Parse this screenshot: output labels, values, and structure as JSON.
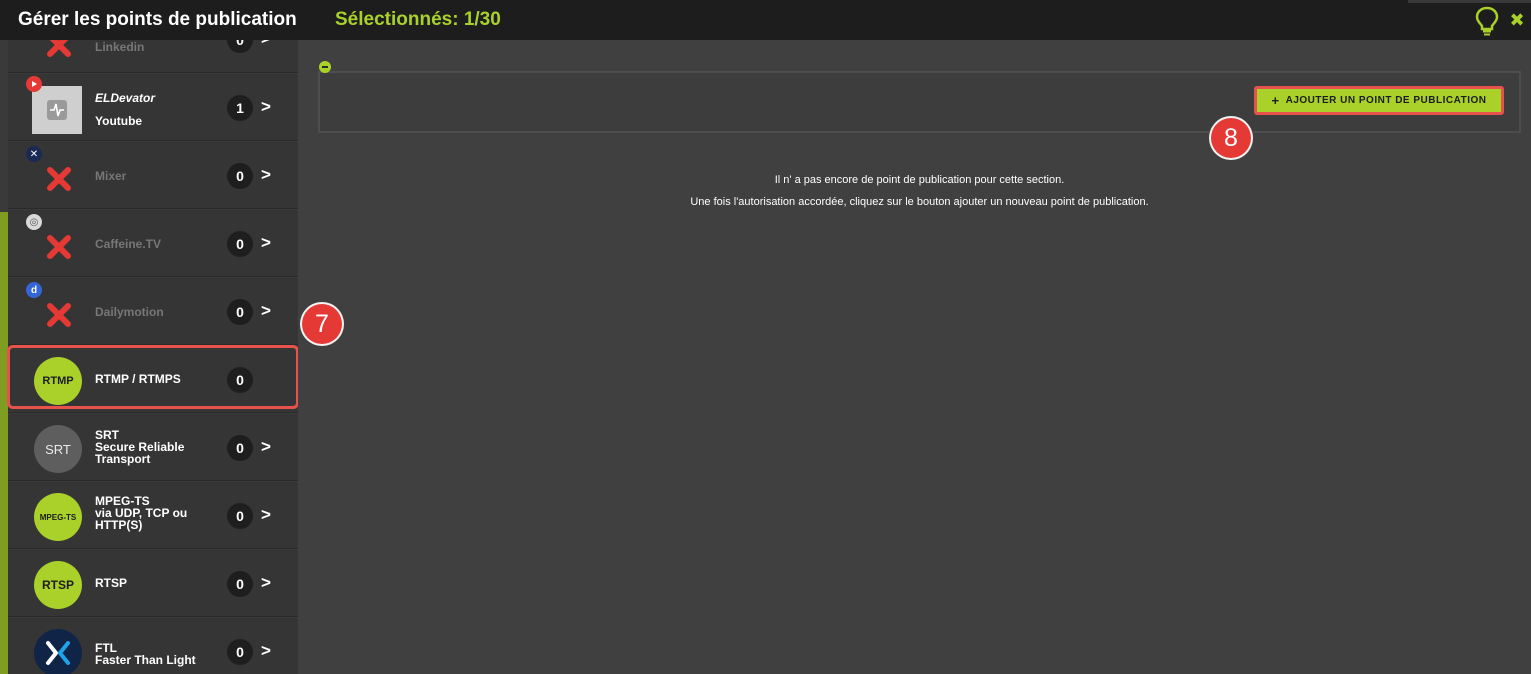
{
  "header": {
    "title": "Gérer les points de publication",
    "selected": "Sélectionnés: 1/30",
    "close_glyph": "✖"
  },
  "colors": {
    "accent": "#a9d12a",
    "highlight": "#e8524c",
    "badge": "#e53935"
  },
  "sidebar": {
    "items": [
      {
        "label": "Linkedin",
        "count": "0",
        "icon": "linkedin-icon",
        "enabled": false
      },
      {
        "label": "ELDevator",
        "sublabel": "Youtube",
        "count": "1",
        "icon": "youtube-icon",
        "enabled": true
      },
      {
        "label": "Mixer",
        "count": "0",
        "icon": "mixer-icon",
        "enabled": false
      },
      {
        "label": "Caffeine.TV",
        "count": "0",
        "icon": "caffeine-icon",
        "enabled": false
      },
      {
        "label": "Dailymotion",
        "count": "0",
        "icon": "dailymotion-icon",
        "enabled": false,
        "mini": "d"
      },
      {
        "label": "RTMP / RTMPS",
        "count": "0",
        "logo": "RTMP",
        "icon": "rtmp-icon",
        "enabled": true
      },
      {
        "label_lines": [
          "SRT",
          "Secure Reliable",
          "Transport"
        ],
        "count": "0",
        "logo": "SRT",
        "icon": "srt-icon",
        "enabled": true
      },
      {
        "label_lines": [
          "MPEG-TS",
          "via UDP, TCP ou",
          "HTTP(S)"
        ],
        "count": "0",
        "logo": "MPEG-TS",
        "icon": "mpegts-icon",
        "enabled": true
      },
      {
        "label": "RTSP",
        "count": "0",
        "logo": "RTSP",
        "icon": "rtsp-icon",
        "enabled": true
      },
      {
        "label_lines": [
          "FTL",
          "Faster Than Light"
        ],
        "count": "0",
        "icon": "ftl-icon",
        "enabled": true
      }
    ]
  },
  "annotations": {
    "step7": "7",
    "step8": "8"
  },
  "main": {
    "add_button_label": "AJOUTER UN POINT DE PUBLICATION",
    "empty_line1": "Il n' a pas encore de point de publication pour cette section.",
    "empty_line2": "Une fois l'autorisation accordée, cliquez sur le bouton ajouter un nouveau point de publication."
  }
}
